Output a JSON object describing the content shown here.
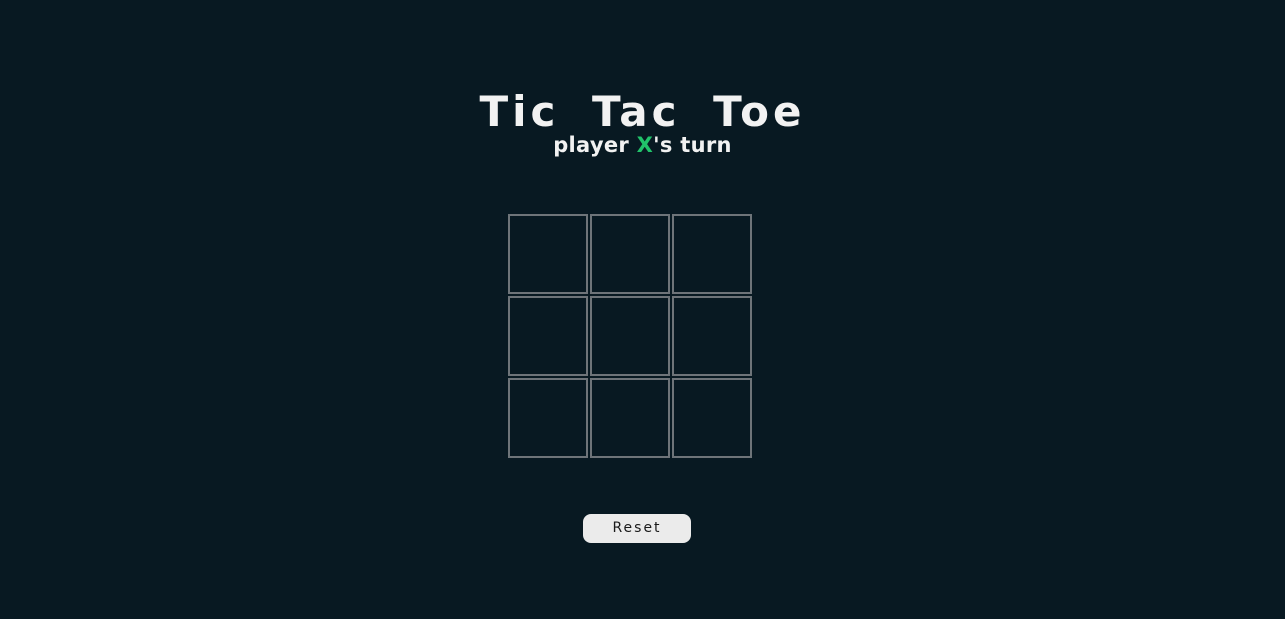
{
  "game": {
    "title": "Tic Tac Toe",
    "status": {
      "prefix": "player ",
      "player": "X",
      "suffix": "'s turn"
    },
    "board": {
      "cells": [
        "",
        "",
        "",
        "",
        "",
        "",
        "",
        "",
        ""
      ]
    },
    "reset_label": "Reset"
  },
  "colors": {
    "background": "#081922",
    "text": "#f2f2f2",
    "accent": "#21c26a",
    "cell_border": "#6e7479",
    "button_bg": "#ebebeb"
  }
}
